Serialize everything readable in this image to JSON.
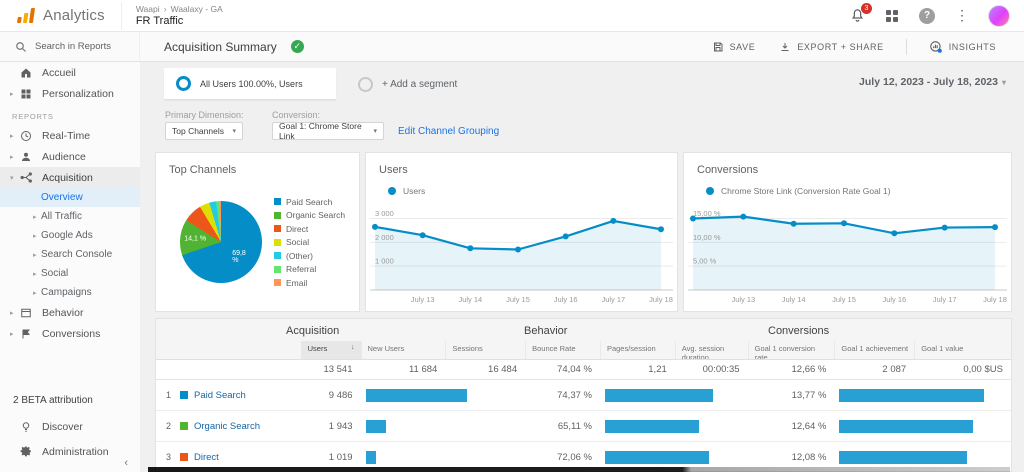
{
  "app": {
    "product": "Analytics",
    "breadcrumb_account": "Waapi",
    "breadcrumb_property": "Waalaxy - GA",
    "view_name": "FR Traffic",
    "notification_count": "3"
  },
  "subbar": {
    "search_placeholder": "Search in Reports",
    "report_title": "Acquisition Summary",
    "save": "SAVE",
    "export_share": "EXPORT + SHARE",
    "insights": "INSIGHTS"
  },
  "sidebar": {
    "items": [
      {
        "label": "Accueil",
        "icon": "home"
      },
      {
        "label": "Personalization",
        "icon": "personalization",
        "arrow": "right"
      },
      {
        "label": "REPORTS",
        "type": "section"
      },
      {
        "label": "Real-Time",
        "icon": "clock",
        "arrow": "right"
      },
      {
        "label": "Audience",
        "icon": "person",
        "arrow": "right"
      },
      {
        "label": "Acquisition",
        "icon": "acquisition",
        "arrow": "down",
        "active": true
      },
      {
        "label": "Overview",
        "type": "child",
        "selected": true
      },
      {
        "label": "All Traffic",
        "type": "child",
        "arrow": "right"
      },
      {
        "label": "Google Ads",
        "type": "child",
        "arrow": "right"
      },
      {
        "label": "Search Console",
        "type": "child",
        "arrow": "right"
      },
      {
        "label": "Social",
        "type": "child",
        "arrow": "right"
      },
      {
        "label": "Campaigns",
        "type": "child",
        "arrow": "right"
      },
      {
        "label": "Behavior",
        "icon": "behavior",
        "arrow": "right"
      },
      {
        "label": "Conversions",
        "icon": "flag",
        "arrow": "right"
      }
    ],
    "beta_label": "2 BETA attribution",
    "discover": "Discover",
    "administration": "Administration"
  },
  "segments": {
    "all_users_title": "All Users",
    "all_users_detail": "100.00%, Users",
    "add_segment": "+ Add a segment",
    "date_range": "July 12, 2023 - July 18, 2023"
  },
  "controls": {
    "primary_dimension_label": "Primary Dimension:",
    "primary_dimension_value": "Top Channels",
    "conversion_label": "Conversion:",
    "conversion_value": "Goal 1: Chrome Store Link",
    "edit_channel_grouping": "Edit Channel Grouping"
  },
  "chart_data": [
    {
      "type": "pie",
      "title": "Top Channels",
      "slices": [
        {
          "label": "Paid Search",
          "pct": 69.8,
          "color": "#058dc7"
        },
        {
          "label": "Organic Search",
          "pct": 14.1,
          "color": "#50b432"
        },
        {
          "label": "Direct",
          "pct": 7.5,
          "color": "#ed561b"
        },
        {
          "label": "Social",
          "pct": 4.0,
          "color": "#dddf00"
        },
        {
          "label": "(Other)",
          "pct": 2.7,
          "color": "#24cbe5"
        },
        {
          "label": "Referral",
          "pct": 1.3,
          "color": "#64e572"
        },
        {
          "label": "Email",
          "pct": 0.6,
          "color": "#ff9655"
        }
      ],
      "slice_labels": [
        {
          "slice": 0,
          "text": "69,8 %"
        },
        {
          "slice": 1,
          "text": "14,1 %"
        }
      ],
      "legend_position": "right"
    },
    {
      "type": "line",
      "title": "Users",
      "legend": "Users",
      "color": "#058dc7",
      "x": [
        "July 12",
        "July 13",
        "July 14",
        "July 15",
        "July 16",
        "July 17",
        "July 18"
      ],
      "values": [
        2650,
        2300,
        1750,
        1700,
        2250,
        2900,
        2550
      ],
      "x_tick_labels": [
        "July 13",
        "July 14",
        "July 15",
        "July 16",
        "July 17",
        "July 18"
      ],
      "yticks": [
        {
          "v": 1000,
          "label": "1 000"
        },
        {
          "v": 2000,
          "label": "2 000"
        },
        {
          "v": 3000,
          "label": "3 000"
        }
      ],
      "ylim": [
        0,
        3400
      ],
      "grid": true
    },
    {
      "type": "line",
      "title": "Conversions",
      "legend": "Chrome Store Link (Conversion Rate Goal 1)",
      "color": "#058dc7",
      "x": [
        "July 12",
        "July 13",
        "July 14",
        "July 15",
        "July 16",
        "July 17",
        "July 18"
      ],
      "values": [
        15.0,
        15.4,
        13.9,
        14.0,
        11.9,
        13.1,
        13.2
      ],
      "x_tick_labels": [
        "July 13",
        "July 14",
        "July 15",
        "July 16",
        "July 17",
        "July 18"
      ],
      "yticks": [
        {
          "v": 5,
          "label": "5,00 %"
        },
        {
          "v": 10,
          "label": "10,00 %"
        },
        {
          "v": 15,
          "label": "15,00 %"
        }
      ],
      "ylim": [
        0,
        17
      ],
      "grid": true
    }
  ],
  "table": {
    "groups": [
      {
        "label": "Acquisition"
      },
      {
        "label": "Behavior"
      },
      {
        "label": "Conversions"
      }
    ],
    "columns": [
      "Users",
      "New Users",
      "Sessions",
      "Bounce Rate",
      "Pages/session",
      "Avg. session duration",
      "Goal 1 conversion rate",
      "Goal 1 achievement",
      "Goal 1 value"
    ],
    "sorted_column": "Users",
    "totals": [
      "13 541",
      "11 684",
      "16 484",
      "74,04 %",
      "1,21",
      "00:00:35",
      "12,66 %",
      "2 087",
      "0,00 $US"
    ],
    "users_total_n": 13541,
    "goal_max_n": 13.77,
    "rows": [
      {
        "rank": "1",
        "channel": "Paid Search",
        "color": "#058dc7",
        "users": "9 486",
        "users_n": 9486,
        "bounce": "74,37 %",
        "bounce_n": 74.37,
        "goal": "13,77 %",
        "goal_n": 13.77
      },
      {
        "rank": "2",
        "channel": "Organic Search",
        "color": "#50b432",
        "users": "1 943",
        "users_n": 1943,
        "bounce": "65,11 %",
        "bounce_n": 65.11,
        "goal": "12,64 %",
        "goal_n": 12.64
      },
      {
        "rank": "3",
        "channel": "Direct",
        "color": "#ed561b",
        "users": "1 019",
        "users_n": 1019,
        "bounce": "72,06 %",
        "bounce_n": 72.06,
        "goal": "12,08 %",
        "goal_n": 12.08
      }
    ]
  }
}
